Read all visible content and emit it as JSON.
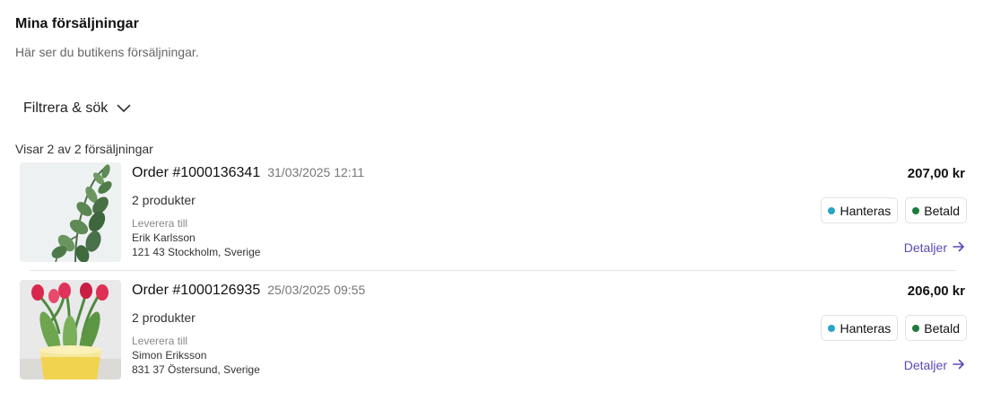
{
  "header": {
    "title": "Mina försäljningar",
    "subtitle": "Här ser du butikens försäljningar."
  },
  "filter": {
    "label": "Filtrera & sök",
    "icon": "chevron-down-icon"
  },
  "results": {
    "summary": "Visar 2 av 2 försäljningar"
  },
  "colors": {
    "processing_dot": "#2aa4c9",
    "paid_dot": "#1f7a3f",
    "link": "#5b48b8"
  },
  "orders": [
    {
      "number": "Order #1000136341",
      "date": "31/03/2025 12:11",
      "product_count": "2 produkter",
      "deliver_label": "Leverera till",
      "customer_name": "Erik Karlsson",
      "address": "121 43 Stockholm, Sverige",
      "total": "207,00 kr",
      "status": "Hanteras",
      "payment": "Betald",
      "details_label": "Detaljer",
      "image": "eucalyptus-plant"
    },
    {
      "number": "Order #1000126935",
      "date": "25/03/2025 09:55",
      "product_count": "2 produkter",
      "deliver_label": "Leverera till",
      "customer_name": "Simon Eriksson",
      "address": "831 37 Östersund, Sverige",
      "total": "206,00 kr",
      "status": "Hanteras",
      "payment": "Betald",
      "details_label": "Detaljer",
      "image": "tulips-in-yellow-pot"
    }
  ]
}
